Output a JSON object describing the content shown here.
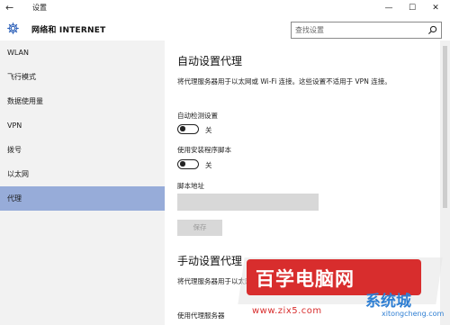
{
  "window": {
    "title": "设置",
    "back_glyph": "←",
    "min_glyph": "—",
    "max_glyph": "☐",
    "close_glyph": "✕"
  },
  "header": {
    "title": "网络和 INTERNET",
    "search_placeholder": "查找设置",
    "icons": [
      "gear-icon",
      "search-icon"
    ]
  },
  "sidebar": {
    "items": [
      {
        "label": "WLAN",
        "selected": false
      },
      {
        "label": "飞行模式",
        "selected": false
      },
      {
        "label": "数据使用量",
        "selected": false
      },
      {
        "label": "VPN",
        "selected": false
      },
      {
        "label": "拨号",
        "selected": false
      },
      {
        "label": "以太网",
        "selected": false
      },
      {
        "label": "代理",
        "selected": true
      }
    ]
  },
  "auto_proxy": {
    "heading": "自动设置代理",
    "description": "将代理服务器用于以太网或 Wi-Fi 连接。这些设置不适用于 VPN 连接。",
    "auto_detect_label": "自动检测设置",
    "auto_detect_state": "关",
    "script_label": "使用安装程序脚本",
    "script_state": "关",
    "address_label": "脚本地址",
    "address_value": "",
    "save_label": "保存"
  },
  "manual_proxy": {
    "heading": "手动设置代理",
    "description": "将代理服务器用于以太网或 Wi-Fi 连接。这些设置不适用于 VPN 连接。",
    "use_proxy_label": "使用代理服务器"
  },
  "watermark": {
    "text": "百学电脑网",
    "url": "www.zix5.com",
    "logo": "系统城",
    "logo_sub": "xitongcheng.com"
  },
  "colors": {
    "selected_nav": "#97acd9",
    "sidebar_bg": "#f2f2f2",
    "watermark_red": "#d82d2d",
    "watermark_blue": "#2f7fd3"
  }
}
